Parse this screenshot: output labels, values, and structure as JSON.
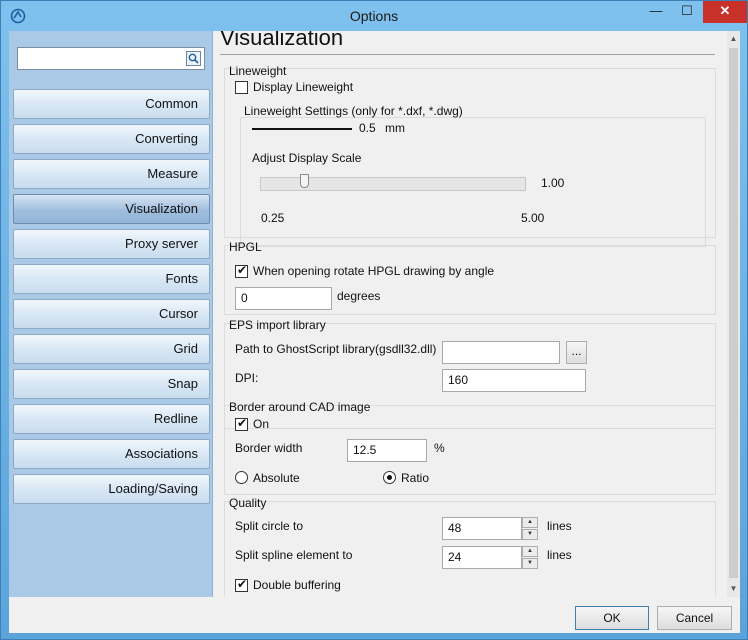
{
  "window": {
    "title": "Options",
    "minimize_glyph": "—",
    "maximize_glyph": "☐",
    "close_glyph": "✕"
  },
  "sidebar": {
    "search": {
      "value": "",
      "icon": "search-icon"
    },
    "items": [
      {
        "label": "Common",
        "active": false
      },
      {
        "label": "Converting",
        "active": false
      },
      {
        "label": "Measure",
        "active": false
      },
      {
        "label": "Visualization",
        "active": true
      },
      {
        "label": "Proxy server",
        "active": false
      },
      {
        "label": "Fonts",
        "active": false
      },
      {
        "label": "Cursor",
        "active": false
      },
      {
        "label": "Grid",
        "active": false
      },
      {
        "label": "Snap",
        "active": false
      },
      {
        "label": "Redline",
        "active": false
      },
      {
        "label": "Associations",
        "active": false
      },
      {
        "label": "Loading/Saving",
        "active": false
      }
    ]
  },
  "page": {
    "title": "Visualization",
    "lineweight": {
      "title": "Lineweight",
      "display_label": "Display Lineweight",
      "display_checked": false,
      "settings_title": "Lineweight Settings (only for *.dxf, *.dwg)",
      "value": "0.5",
      "unit": "mm",
      "scale_title": "Adjust Display Scale",
      "scale_value": "1.00",
      "scale_min": "0.25",
      "scale_max": "5.00"
    },
    "hpgl": {
      "title": "HPGL",
      "rotate_label": "When opening rotate HPGL drawing by angle",
      "rotate_checked": true,
      "angle_value": "0",
      "angle_unit": "degrees"
    },
    "eps": {
      "title": "EPS import library",
      "path_label": "Path to GhostScript library(gsdll32.dll)",
      "path_value": "",
      "browse_label": "...",
      "dpi_label": "DPI:",
      "dpi_value": "160"
    },
    "border": {
      "title": "Border around CAD image",
      "on_label": "On",
      "on_checked": true,
      "width_label": "Border width",
      "width_value": "12.5",
      "width_unit": "%",
      "absolute_label": "Absolute",
      "ratio_label": "Ratio",
      "selected": "Ratio"
    },
    "quality": {
      "title": "Quality",
      "split_circle_label": "Split circle to",
      "split_circle_value": "48",
      "split_circle_unit": "lines",
      "split_spline_label": "Split spline element to",
      "split_spline_value": "24",
      "split_spline_unit": "lines",
      "double_buffering_label": "Double buffering",
      "double_buffering_checked": true
    }
  },
  "footer": {
    "ok_label": "OK",
    "cancel_label": "Cancel"
  },
  "colors": {
    "window_frame": "#6fb3e6",
    "close_button": "#c7312a",
    "sidebar_bg": "#aac9e6",
    "active_item": "#9fbedd"
  }
}
